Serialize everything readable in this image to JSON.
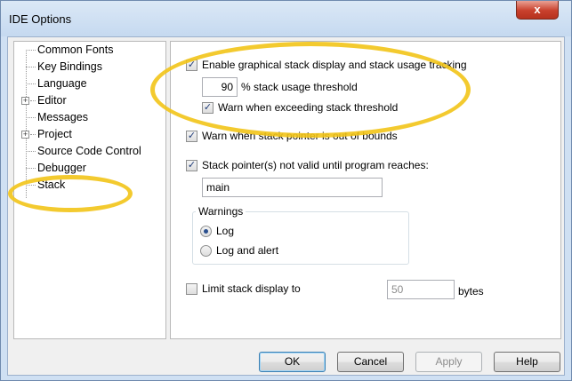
{
  "window": {
    "title": "IDE Options",
    "close_glyph": "x"
  },
  "tree": {
    "items": [
      {
        "label": "Common Fonts",
        "expandable": false
      },
      {
        "label": "Key Bindings",
        "expandable": false
      },
      {
        "label": "Language",
        "expandable": false
      },
      {
        "label": "Editor",
        "expandable": true
      },
      {
        "label": "Messages",
        "expandable": false
      },
      {
        "label": "Project",
        "expandable": true
      },
      {
        "label": "Source Code Control",
        "expandable": false
      },
      {
        "label": "Debugger",
        "expandable": false
      },
      {
        "label": "Stack",
        "expandable": false,
        "selected": true
      }
    ],
    "expander_glyph": "+"
  },
  "stack_panel": {
    "enable_graphical": {
      "label": "Enable graphical stack display and stack usage tracking",
      "checked": true
    },
    "threshold": {
      "value": "90",
      "label": "% stack usage threshold"
    },
    "warn_threshold": {
      "label": "Warn when exceeding stack threshold",
      "checked": true
    },
    "warn_out_of_bounds": {
      "label": "Warn when stack pointer is out of bounds",
      "checked": true
    },
    "pointer_not_valid": {
      "label": "Stack pointer(s) not valid until program reaches:",
      "checked": true,
      "value": "main"
    },
    "warnings": {
      "title": "Warnings",
      "options": [
        {
          "label": "Log",
          "selected": true
        },
        {
          "label": "Log and alert",
          "selected": false
        }
      ]
    },
    "limit_display": {
      "label": "Limit stack display to",
      "checked": false,
      "value": "50",
      "unit": "bytes"
    }
  },
  "buttons": {
    "ok": "OK",
    "cancel": "Cancel",
    "apply": "Apply",
    "help": "Help"
  },
  "highlight_color": "#f2c418",
  "check_glyph": "✓"
}
